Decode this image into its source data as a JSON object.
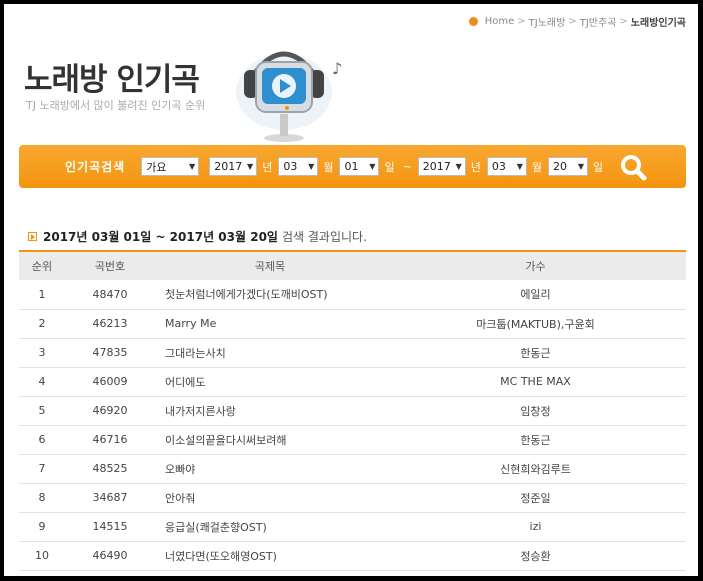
{
  "breadcrumb": {
    "items": [
      "Home",
      "TJ노래방",
      "TJ반주곡"
    ],
    "current": "노래방인기곡",
    "separator": ">"
  },
  "header": {
    "title": "노래방 인기곡",
    "subtitle": "TJ 노래방에서 많이 불려진 인기곡 순위"
  },
  "search": {
    "label": "인기곡검색",
    "genre": "가요",
    "from": {
      "year": "2017",
      "month": "03",
      "day": "01"
    },
    "to": {
      "year": "2017",
      "month": "03",
      "day": "20"
    },
    "units": {
      "year": "년",
      "month": "월",
      "day": "일"
    },
    "tilde": "~"
  },
  "result": {
    "range": "2017년 03월 01일 ~ 2017년 03월 20일",
    "suffix": "검색 결과입니다."
  },
  "table": {
    "headers": {
      "rank": "순위",
      "number": "곡번호",
      "title": "곡제목",
      "artist": "가수"
    },
    "rows": [
      {
        "rank": "1",
        "number": "48470",
        "title": "첫눈처럼너에게가겠다(도깨비OST)",
        "artist": "에일리"
      },
      {
        "rank": "2",
        "number": "46213",
        "title": "Marry Me",
        "artist": "마크툽(MAKTUB),구윤회"
      },
      {
        "rank": "3",
        "number": "47835",
        "title": "그대라는사치",
        "artist": "한동근"
      },
      {
        "rank": "4",
        "number": "46009",
        "title": "어디에도",
        "artist": "MC THE MAX"
      },
      {
        "rank": "5",
        "number": "46920",
        "title": "내가저지른사랑",
        "artist": "임창정"
      },
      {
        "rank": "6",
        "number": "46716",
        "title": "이소설의끝을다시써보려해",
        "artist": "한동근"
      },
      {
        "rank": "7",
        "number": "48525",
        "title": "오빠야",
        "artist": "신현희와김루트"
      },
      {
        "rank": "8",
        "number": "34687",
        "title": "안아줘",
        "artist": "정준일"
      },
      {
        "rank": "9",
        "number": "14515",
        "title": "응급실(쾌걸춘향OST)",
        "artist": "izi"
      },
      {
        "rank": "10",
        "number": "46490",
        "title": "너였다면(또오해영OST)",
        "artist": "정승환"
      }
    ]
  },
  "colors": {
    "accent": "#f39410",
    "accent_light": "#f9a830",
    "header_bg": "#ebebeb"
  },
  "icons": {
    "search": "magnifier-icon",
    "mascot": "tv-mascot-icon"
  }
}
